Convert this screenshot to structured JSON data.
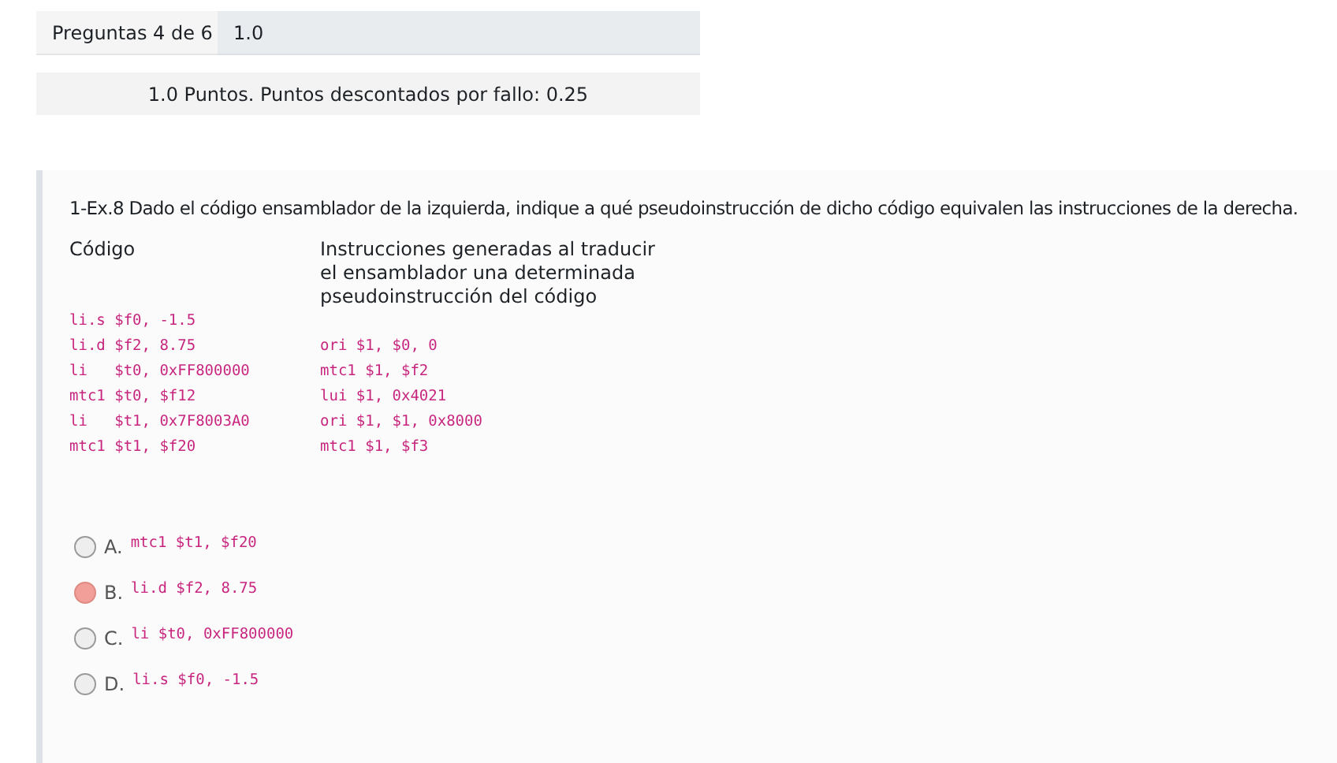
{
  "header": {
    "label": "Preguntas 4 de 6",
    "value": "1.0"
  },
  "points": "1.0 Puntos. Puntos descontados por fallo: 0.25",
  "question": {
    "text": "1-Ex.8 Dado el código ensamblador de la izquierda, indique a qué pseudoinstrucción de dicho código equivalen las instrucciones de la derecha.",
    "left_heading": "Código",
    "left_code": [
      "li.s $f0, -1.5",
      "li.d $f2, 8.75",
      "li   $t0, 0xFF800000",
      "mtc1 $t0, $f12",
      "li   $t1, 0x7F8003A0",
      "mtc1 $t1, $f20"
    ],
    "right_heading": "Instrucciones generadas al traducir el ensamblador una determinada pseudoinstrucción del código",
    "right_code": [
      "ori $1, $0, 0",
      "mtc1 $1, $f2",
      "lui $1, 0x4021",
      "ori $1, $1, 0x8000",
      "mtc1 $1, $f3"
    ]
  },
  "options": [
    {
      "letter": "A.",
      "code": "mtc1 $t1, $f20",
      "selected": false
    },
    {
      "letter": "B.",
      "code": "li.d $f2, 8.75",
      "selected": true
    },
    {
      "letter": "C.",
      "code": "li $t0, 0xFF800000",
      "selected": false
    },
    {
      "letter": "D.",
      "code": "li.s $f0, -1.5",
      "selected": false
    }
  ]
}
